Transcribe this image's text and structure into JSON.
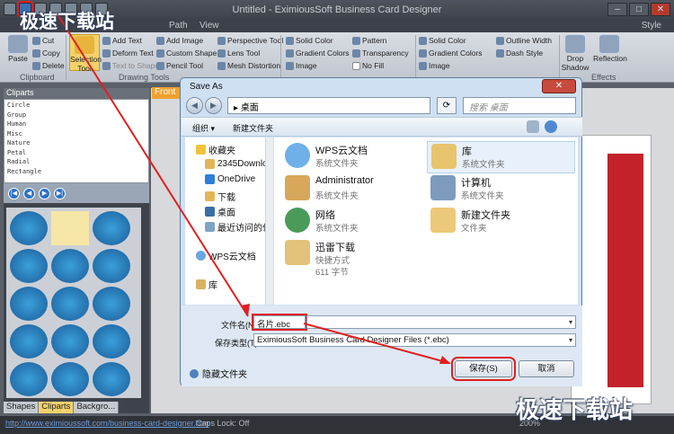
{
  "app": {
    "window_title": "Untitled - EximiousSoft Business Card Designer",
    "tabs": [
      "Path",
      "View"
    ],
    "style_label": "Style",
    "win_buttons": [
      "–",
      "□",
      "✕"
    ]
  },
  "watermark": {
    "top": "极速下载站",
    "bottom": "极速下载站"
  },
  "ribbon": {
    "clipboard": {
      "paste": "Paste",
      "cut": "Cut",
      "copy": "Copy",
      "delete": "Delete",
      "group": "Clipboard"
    },
    "drawing": {
      "selection_tool": "Selection Tool",
      "add_text": "Add Text",
      "add_image": "Add Image",
      "perspective_tool": "Perspective Tool",
      "deform_text": "Deform Text",
      "custom_shape": "Custom Shape",
      "lens_tool": "Lens Tool",
      "text_to_shape": "Text to Shape",
      "pencil_tool": "Pencil Tool",
      "mesh_distortion": "Mesh Distortion",
      "group": "Drawing Tools"
    },
    "fill": {
      "solid_color": "Solid Color",
      "gradient_colors": "Gradient Colors",
      "image": "Image",
      "pattern": "Pattern",
      "transparency": "Transparency",
      "no_fill": "No Fill"
    },
    "line": {
      "solid_color": "Solid Color",
      "gradient_colors": "Gradient Colors",
      "image": "Image",
      "outline_width": "Outline Width",
      "dash_style": "Dash Style"
    },
    "effects": {
      "drop_shadow": "Drop Shadow",
      "reflection": "Reflection",
      "group": "Effects"
    }
  },
  "left_panel": {
    "title": "Cliparts",
    "categories": [
      "Circle",
      "Group",
      "Human",
      "Misc",
      "Nature",
      "Petal",
      "Radial",
      "Rectangle"
    ],
    "nav": [
      "|◀",
      "◀",
      "▶",
      "▶|"
    ],
    "tabs": [
      "Shapes",
      "Cliparts",
      "Backgro..."
    ],
    "active_tab": "Cliparts"
  },
  "canvas": {
    "front_tab": "Front"
  },
  "status_bar": {
    "url": "http://www.eximioussoft.com/business-card-designer.htm",
    "caps_lock": "Caps Lock: Off",
    "zoom": "200%"
  },
  "dialog": {
    "title": "Save As",
    "close": "✕",
    "address": "桌面",
    "address_arrow": "▸",
    "search_placeholder": "搜索 桌面",
    "toolbar": {
      "organize": "组织 ▾",
      "new_folder": "新建文件夹"
    },
    "nav_items": [
      "收藏夹",
      "2345Downlo",
      "OneDrive",
      "下载",
      "桌面",
      "最近访问的位",
      "WPS云文档",
      "库"
    ],
    "files": [
      {
        "name": "WPS云文档",
        "type": "系统文件夹"
      },
      {
        "name": "库",
        "type": "系统文件夹"
      },
      {
        "name": "Administrator",
        "type": "系统文件夹"
      },
      {
        "name": "计算机",
        "type": "系统文件夹"
      },
      {
        "name": "网络",
        "type": "系统文件夹"
      },
      {
        "name": "新建文件夹",
        "type": "文件夹"
      },
      {
        "name": "迅雷下载",
        "type": "快捷方式",
        "size": "611 字节"
      }
    ],
    "filename_label": "文件名(N):",
    "filename_value": "名片.ebc",
    "filetype_label": "保存类型(T):",
    "filetype_value": "EximiousSoft Business Card Designer Files (*.ebc)",
    "hide_folders": "隐藏文件夹",
    "save_button": "保存(S)",
    "cancel_button": "取消"
  }
}
